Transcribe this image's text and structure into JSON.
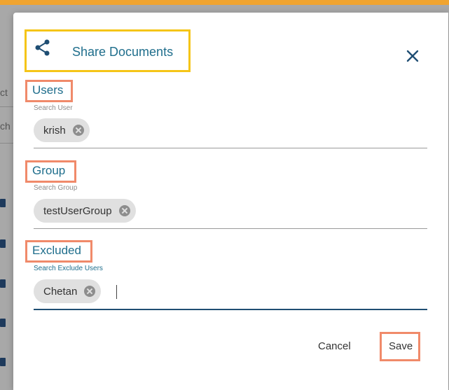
{
  "dialog": {
    "title": "Share Documents",
    "share_icon": "share-icon",
    "close_icon": "close-icon"
  },
  "users": {
    "label": "Users",
    "caption": "Search User",
    "chips": [
      "krish"
    ]
  },
  "group": {
    "label": "Group",
    "caption": "Search Group",
    "chips": [
      "testUserGroup"
    ]
  },
  "excluded": {
    "label": "Excluded",
    "caption": "Search Exclude Users",
    "chips": [
      "Chetan"
    ]
  },
  "footer": {
    "cancel_label": "Cancel",
    "save_label": "Save"
  },
  "colors": {
    "accent": "#1f6e8c",
    "highlight_yellow": "#f5c518",
    "highlight_orange": "#f08a6a",
    "chip_bg": "#e0e0e0"
  }
}
